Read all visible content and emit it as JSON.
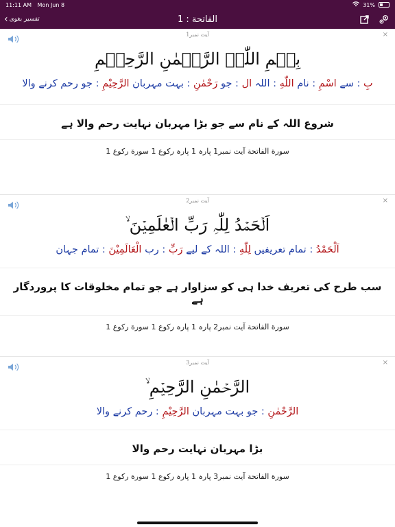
{
  "status": {
    "time": "11:11 AM",
    "date": "Mon Jun 8",
    "battery": "31%",
    "battery_level": 0.31
  },
  "nav": {
    "back_label": "تفسیر بغوی",
    "title": "الفاتحة : 1"
  },
  "colors": {
    "bar": "#4a0f3f",
    "arabic_word": "#b4181c",
    "urdu_word": "#1f3da5"
  },
  "icons": {
    "back": "chevron-left-icon",
    "share": "share-icon",
    "settings": "gear-icon",
    "audio": "speaker-icon",
    "menu": "close-icon"
  },
  "verses": [
    {
      "label": "آیت نمبر1",
      "arabic": "بِسۡمِ اللّٰہِ الرَّحۡمٰنِ الرَّحِیۡمِ",
      "words": [
        {
          "ar": "بِ",
          "ur": "سے"
        },
        {
          "ar": "اسْمِ",
          "ur": "نام"
        },
        {
          "ar": "اللّٰهِ",
          "ur": "اللہ"
        },
        {
          "ar": "ال",
          "ur": "جو"
        },
        {
          "ar": "رَحْمٰنِ",
          "ur": "بہت مہربان"
        },
        {
          "ar": "الرَّحِيْمِ",
          "ur": "جو رحم کرنے والا"
        }
      ],
      "translation": "شروع اللہ کے نام سے جو بڑا مہربان نہایت رحم والا ہے",
      "reference": "سورة الفاتحة آیت نمبر1 پارہ 1 پارہ رکوع 1 سورة رکوع 1"
    },
    {
      "label": "آیت نمبر2",
      "arabic": "اَلۡحَمۡدُ لِلّٰہِ رَبِّ الۡعٰلَمِیۡنَ ۙ",
      "words": [
        {
          "ar": "اَلْحَمْدُ",
          "ur": "تمام تعریفیں"
        },
        {
          "ar": "لِلّٰهِ",
          "ur": "اللہ کے لیے"
        },
        {
          "ar": "رَبِّ",
          "ur": "رب"
        },
        {
          "ar": "الْعَالَمِيْنَ",
          "ur": "تمام جہان"
        }
      ],
      "translation": "سب طرح کی تعریف خدا ہی کو سزاوار ہے جو تمام مخلوقات کا پروردگار ہے",
      "reference": "سورة الفاتحة آیت نمبر2 پارہ 1 پارہ رکوع 1 سورة رکوع 1"
    },
    {
      "label": "آیت نمبر3",
      "arabic": "الرَّحۡمٰنِ الرَّحِیۡمِ ۙ",
      "words": [
        {
          "ar": "الرَّحْمٰنِ",
          "ur": "جو بہت مہربان"
        },
        {
          "ar": "الرَّحِيْمِ",
          "ur": "رحم کرنے والا"
        }
      ],
      "translation": "بڑا مہربان نہایت رحم والا",
      "reference": "سورة الفاتحة آیت نمبر3 پارہ 1 پارہ رکوع 1 سورة رکوع 1"
    }
  ]
}
